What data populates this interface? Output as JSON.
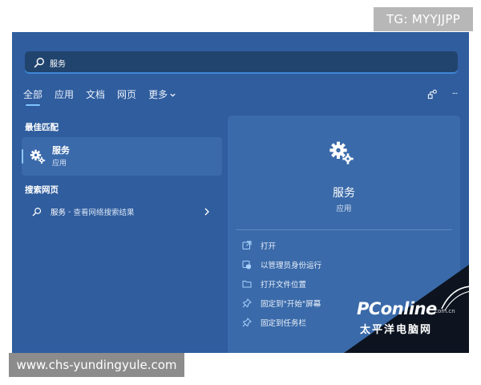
{
  "watermark": {
    "tg": "TG: MYYJJPP",
    "caption": "www.chs-yundingyule.com"
  },
  "search": {
    "value": "服务",
    "icon": "search-icon"
  },
  "tabs": [
    {
      "label": "全部",
      "active": true
    },
    {
      "label": "应用",
      "active": false
    },
    {
      "label": "文档",
      "active": false
    },
    {
      "label": "网页",
      "active": false
    },
    {
      "label": "更多",
      "active": false,
      "icon": "chevron-down-icon"
    }
  ],
  "top_right": {
    "icons": [
      "share-icon",
      "more-icon"
    ],
    "more_glyph": "···"
  },
  "best_match": {
    "heading": "最佳匹配",
    "item": {
      "title": "服务",
      "subtitle": "应用",
      "icon": "gear-icon"
    }
  },
  "web_search": {
    "heading": "搜索网页",
    "item": {
      "query": "服务",
      "separator": "-",
      "description": "查看网络搜索结果",
      "icon": "search-icon"
    }
  },
  "detail_panel": {
    "title": "服务",
    "subtitle": "应用",
    "icon": "gear-icon",
    "actions": [
      {
        "label": "打开",
        "icon": "open-icon"
      },
      {
        "label": "以管理员身份运行",
        "icon": "shield-icon"
      },
      {
        "label": "打开文件位置",
        "icon": "folder-icon"
      },
      {
        "label": "固定到\"开始\"屏幕",
        "icon": "pin-icon"
      },
      {
        "label": "固定到任务栏",
        "icon": "pin-icon"
      }
    ]
  },
  "logo": {
    "main": "PConline",
    "domain": ".com.cn",
    "chinese": "太平洋电脑网"
  },
  "colors": {
    "background": "#2f5d9e",
    "search_box": "#21446e",
    "accent": "#7fc3ff",
    "panel": "#3a6aa9"
  }
}
